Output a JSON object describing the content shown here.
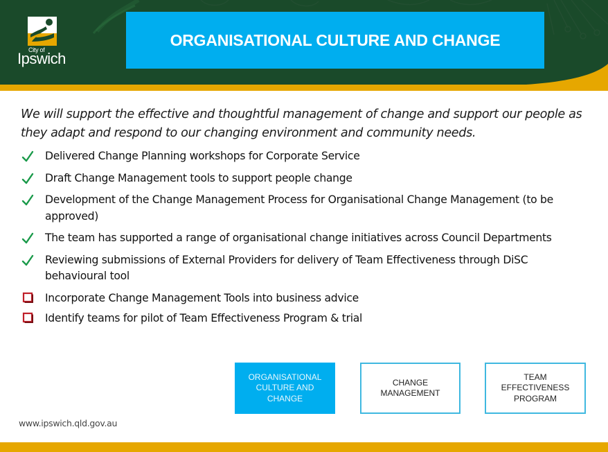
{
  "colors": {
    "header_green": "#1a4a2a",
    "accent_yellow": "#e6a700",
    "title_blue": "#00aeef",
    "check_green": "#1a9a4a",
    "square_red": "#c0202a"
  },
  "logo": {
    "city_label": "City of",
    "name": "Ipswich",
    "icon": "ipswich-logo-icon"
  },
  "header": {
    "title": "ORGANISATIONAL CULTURE AND CHANGE"
  },
  "intro": "We will support the effective and thoughtful management of change and support our people as they adapt and respond to our changing environment and community needs.",
  "items": [
    {
      "status": "done",
      "icon": "checkmark-icon",
      "text": "Delivered Change Planning workshops for Corporate Service"
    },
    {
      "status": "done",
      "icon": "checkmark-icon",
      "text": "Draft Change Management tools to support people change"
    },
    {
      "status": "done",
      "icon": "checkmark-icon",
      "text": "Development of the Change Management Process for Organisational Change Management (to be approved)"
    },
    {
      "status": "done",
      "icon": "checkmark-icon",
      "text": "The team has supported a range of organisational change initiatives across Council Departments"
    },
    {
      "status": "done",
      "icon": "checkmark-icon",
      "text": "Reviewing submissions of External Providers for delivery of Team Effectiveness through DiSC behavioural tool"
    },
    {
      "status": "todo",
      "icon": "checkbox-empty-icon",
      "text": "Incorporate Change Management Tools into business advice"
    },
    {
      "status": "todo",
      "icon": "checkbox-empty-icon",
      "text": "Identify teams for pilot of Team Effectiveness Program & trial"
    }
  ],
  "nav_boxes": [
    {
      "label": "ORGANISATIONAL CULTURE AND CHANGE",
      "active": true
    },
    {
      "label": "CHANGE MANAGEMENT",
      "active": false
    },
    {
      "label": "TEAM EFFECTIVENESS PROGRAM",
      "active": false
    }
  ],
  "footer": {
    "url": "www.ipswich.qld.gov.au"
  }
}
